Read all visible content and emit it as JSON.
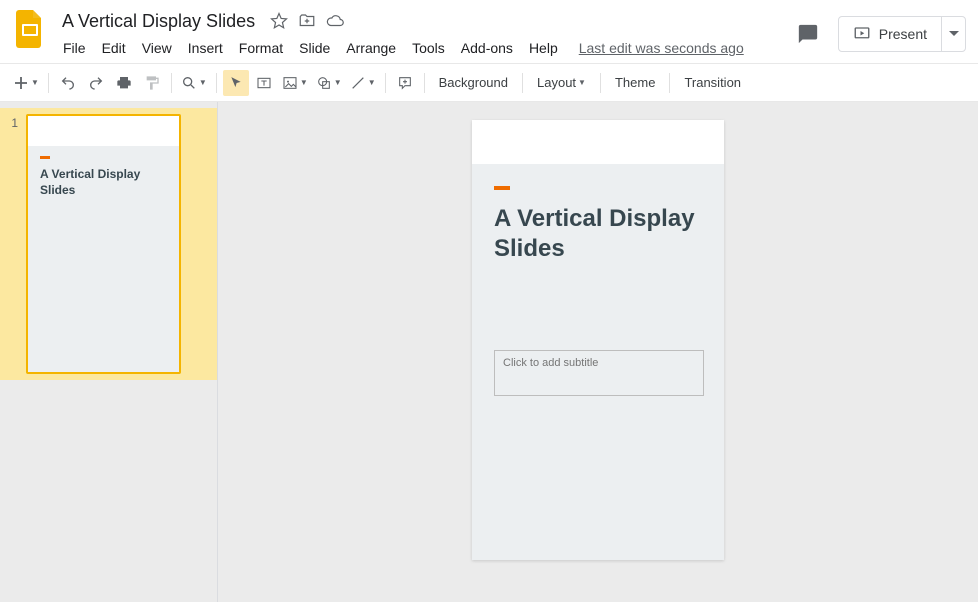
{
  "document": {
    "title": "A Vertical Display Slides",
    "last_edit": "Last edit was seconds ago"
  },
  "menu": {
    "items": [
      "File",
      "Edit",
      "View",
      "Insert",
      "Format",
      "Slide",
      "Arrange",
      "Tools",
      "Add-ons",
      "Help"
    ]
  },
  "present": {
    "label": "Present"
  },
  "toolbar": {
    "background": "Background",
    "layout": "Layout",
    "theme": "Theme",
    "transition": "Transition"
  },
  "filmstrip": {
    "slides": [
      {
        "number": "1",
        "title": "A Vertical Display Slides"
      }
    ]
  },
  "slide": {
    "title": "A Vertical Display Slides",
    "subtitle_placeholder": "Click to add subtitle"
  }
}
